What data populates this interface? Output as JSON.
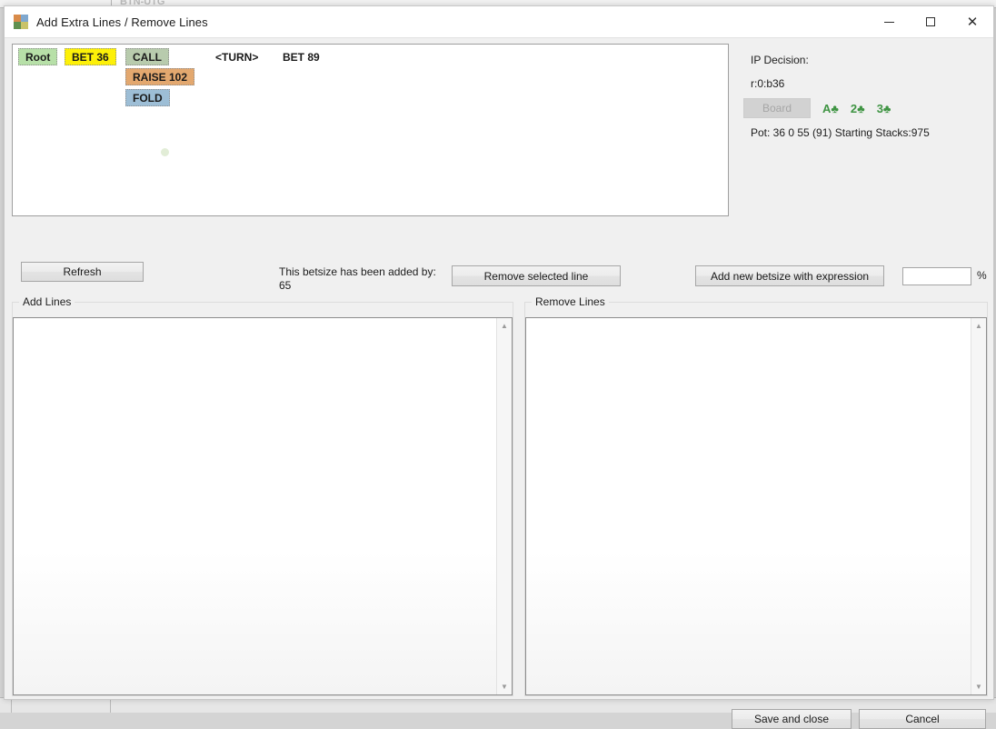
{
  "background": {
    "top_label": "BTN-UTG",
    "bottom_label": ""
  },
  "window": {
    "title": "Add Extra Lines / Remove Lines",
    "icon": "grid-app-icon",
    "controls": {
      "minimize": "minimize-icon",
      "maximize": "maximize-icon",
      "close": "close-icon"
    }
  },
  "tree": {
    "nodes": [
      {
        "label": "Root",
        "color": "green"
      },
      {
        "label": "BET 36",
        "color": "yellow"
      },
      {
        "label": "CALL",
        "color": "sage"
      },
      {
        "label": "",
        "color": "white"
      },
      {
        "label": "<TURN>",
        "color": "white"
      },
      {
        "label": "BET 89",
        "color": "white"
      },
      {
        "label": "RAISE 102",
        "color": "orange"
      },
      {
        "label": "FOLD",
        "color": "blue"
      }
    ]
  },
  "info": {
    "decision_label": "IP Decision:",
    "decision_value": "r:0:b36",
    "board_button": "Board",
    "board_cards": [
      "A♣",
      "2♣",
      "3♣"
    ],
    "card_color": "#3f9443",
    "pot_line": "Pot: 36 0 55 (91) Starting Stacks:975"
  },
  "toolbar": {
    "refresh_label": "Refresh",
    "betsize_note": "This betsize has been added by: 65",
    "remove_selected_label": "Remove selected line",
    "add_expression_label": "Add new betsize with expression",
    "betsize_input_value": "",
    "betsize_input_placeholder": "",
    "percent_label": "%"
  },
  "groups": {
    "add_lines_label": "Add Lines",
    "remove_lines_label": "Remove Lines",
    "add_lines_items": [],
    "remove_lines_items": [],
    "scroll_up_glyph": "▲",
    "scroll_down_glyph": "▼"
  },
  "footer": {
    "save_label": "Save and close",
    "cancel_label": "Cancel"
  }
}
